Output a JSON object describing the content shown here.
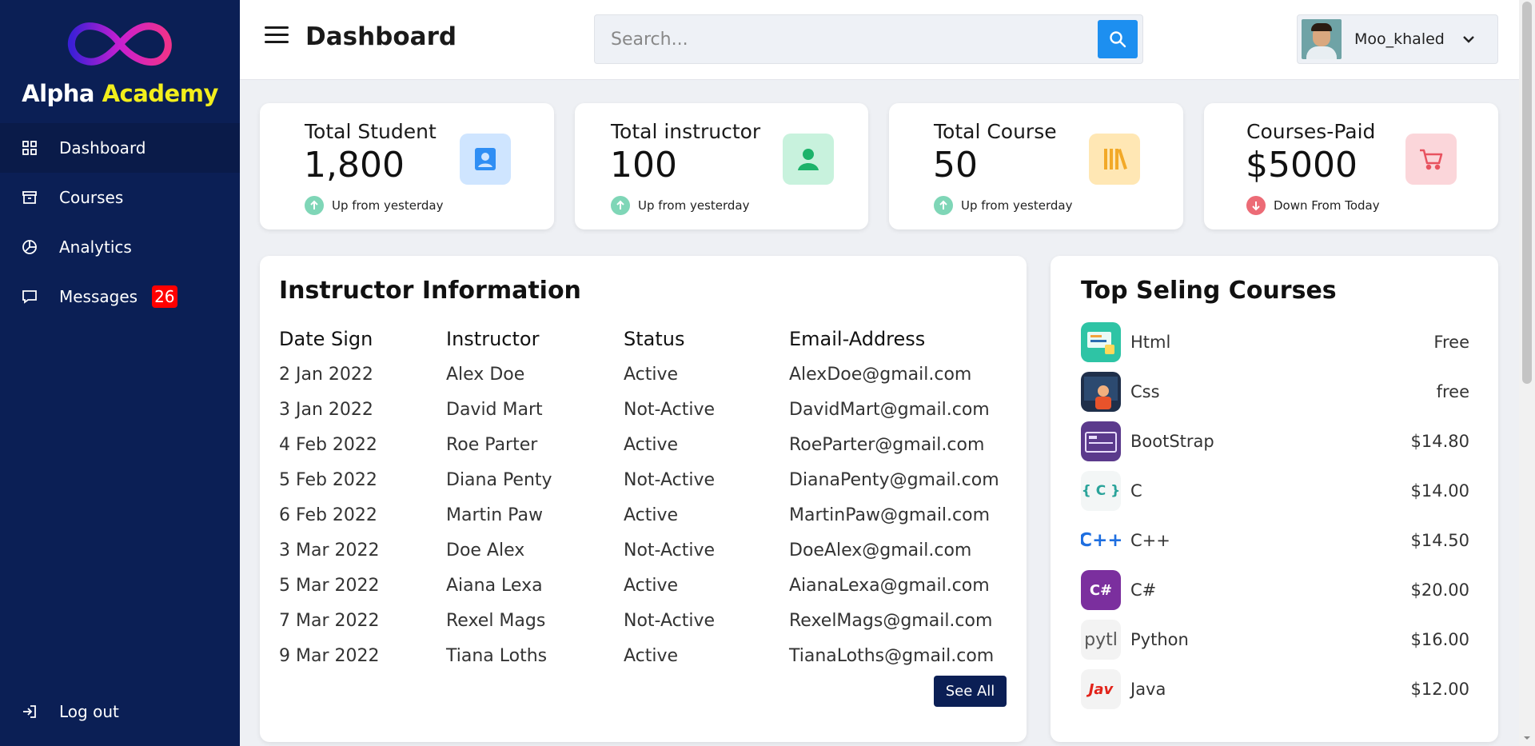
{
  "brand": {
    "name_part1": "Alpha",
    "name_part2": "Academy"
  },
  "sidebar": {
    "items": [
      {
        "label": "Dashboard",
        "icon": "grid-icon"
      },
      {
        "label": "Courses",
        "icon": "archive-icon"
      },
      {
        "label": "Analytics",
        "icon": "pie-chart-icon"
      },
      {
        "label": "Messages",
        "icon": "message-icon",
        "badge": "26"
      }
    ],
    "logout_label": "Log out"
  },
  "header": {
    "title": "Dashboard",
    "search_placeholder": "Search...",
    "username": "Moo_khaled"
  },
  "stats": [
    {
      "title": "Total Student",
      "value": "1,800",
      "trend": "Up from yesterday",
      "direction": "up",
      "icon": "id-badge-icon",
      "icon_bg": "#cfe5ff",
      "icon_color": "#2f8ef4"
    },
    {
      "title": "Total instructor",
      "value": "100",
      "trend": "Up from yesterday",
      "direction": "up",
      "icon": "user-icon",
      "icon_bg": "#c8f2dd",
      "icon_color": "#1cb36a"
    },
    {
      "title": "Total Course",
      "value": "50",
      "trend": "Up from yesterday",
      "direction": "up",
      "icon": "books-icon",
      "icon_bg": "#ffe7b4",
      "icon_color": "#f2a928"
    },
    {
      "title": "Courses-Paid",
      "value": "$5000",
      "trend": "Down From Today",
      "direction": "down",
      "icon": "cart-icon",
      "icon_bg": "#fbd6da",
      "icon_color": "#e8525f"
    }
  ],
  "instructors": {
    "title": "Instructor Information",
    "headers": [
      "Date Sign",
      "Instructor",
      "Status",
      "Email-Address"
    ],
    "rows": [
      [
        "2 Jan 2022",
        "Alex Doe",
        "Active",
        "AlexDoe@gmail.com"
      ],
      [
        "3 Jan 2022",
        "David Mart",
        "Not-Active",
        "DavidMart@gmail.com"
      ],
      [
        "4 Feb 2022",
        "Roe Parter",
        "Active",
        "RoeParter@gmail.com"
      ],
      [
        "5 Feb 2022",
        "Diana Penty",
        "Not-Active",
        "DianaPenty@gmail.com"
      ],
      [
        "6 Feb 2022",
        "Martin Paw",
        "Active",
        "MartinPaw@gmail.com"
      ],
      [
        "3 Mar 2022",
        "Doe Alex",
        "Not-Active",
        "DoeAlex@gmail.com"
      ],
      [
        "5 Mar 2022",
        "Aiana Lexa",
        "Active",
        "AianaLexa@gmail.com"
      ],
      [
        "7 Mar 2022",
        "Rexel Mags",
        "Not-Active",
        "RexelMags@gmail.com"
      ],
      [
        "9 Mar 2022",
        "Tiana Loths",
        "Active",
        "TianaLoths@gmail.com"
      ]
    ],
    "see_all_label": "See All"
  },
  "top_courses": {
    "title": "Top Seling Courses",
    "items": [
      {
        "name": "Html",
        "price": "Free",
        "thumb_text": "",
        "thumb_bg": "#2ec4a5"
      },
      {
        "name": "Css",
        "price": "free",
        "thumb_text": "",
        "thumb_bg": "#1f2f4a"
      },
      {
        "name": "BootStrap",
        "price": "$14.80",
        "thumb_text": "",
        "thumb_bg": "#5b3a8c"
      },
      {
        "name": "C",
        "price": "$14.00",
        "thumb_text": "{ C }",
        "thumb_bg": "#f3f6f6"
      },
      {
        "name": "C++",
        "price": "$14.50",
        "thumb_text": "C++",
        "thumb_bg": "#ffffff"
      },
      {
        "name": "C#",
        "price": "$20.00",
        "thumb_text": "C#",
        "thumb_bg": "#7b2f9e"
      },
      {
        "name": "Python",
        "price": "$16.00",
        "thumb_text": "pytl",
        "thumb_bg": "#f3f3f3"
      },
      {
        "name": "Java",
        "price": "$12.00",
        "thumb_text": "Jav",
        "thumb_bg": "#f3f3f3"
      }
    ]
  }
}
